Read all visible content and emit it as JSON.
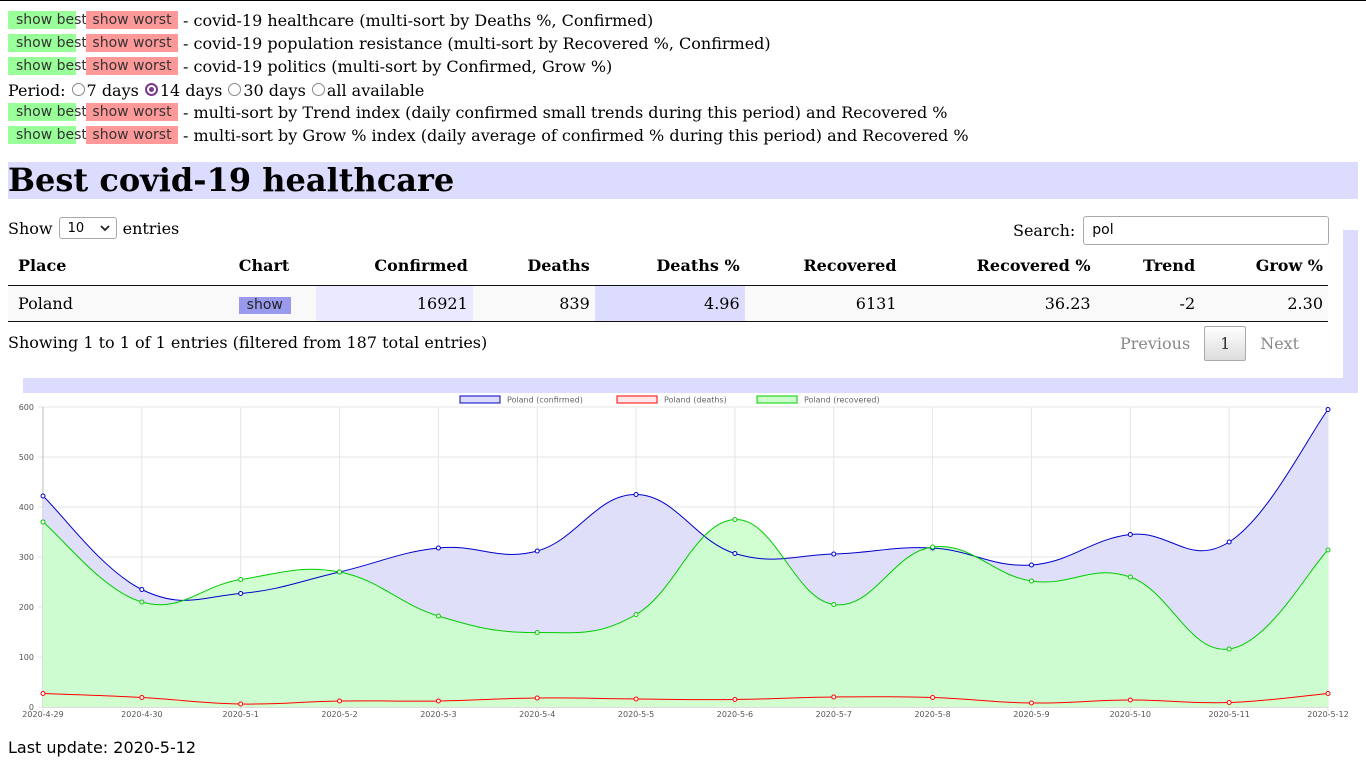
{
  "nav": {
    "best_label": "show best",
    "worst_label": "show worst",
    "rows": [
      {
        "desc": "- covid-19 healthcare (multi-sort by Deaths %, Confirmed)"
      },
      {
        "desc": "- covid-19 population resistance (multi-sort by Recovered %, Confirmed)"
      },
      {
        "desc": "- covid-19 politics (multi-sort by Confirmed, Grow %)"
      }
    ],
    "period_label": "Period:",
    "period_options": [
      "7 days",
      "14 days",
      "30 days",
      "all available"
    ],
    "period_selected": "14 days",
    "period_rows": [
      {
        "desc": "- multi-sort by Trend index (daily confirmed small trends during this period) and Recovered %"
      },
      {
        "desc": "- multi-sort by Grow % index (daily average of confirmed % during this period) and Recovered %"
      }
    ]
  },
  "page_title": "Best covid-19 healthcare",
  "table_controls": {
    "show_label": "Show",
    "entries_value": "10",
    "entries_label": "entries",
    "search_label": "Search:",
    "search_value": "pol"
  },
  "table": {
    "headers": [
      "Place",
      "Chart",
      "Confirmed",
      "Deaths",
      "Deaths %",
      "Recovered",
      "Recovered %",
      "Trend",
      "Grow %"
    ],
    "rows": [
      {
        "place": "Poland",
        "chart_button": "show",
        "confirmed": "16921",
        "deaths": "839",
        "deaths_pct": "4.96",
        "recovered": "6131",
        "recovered_pct": "36.23",
        "trend": "-2",
        "grow_pct": "2.30"
      }
    ],
    "info": "Showing 1 to 1 of 1 entries (filtered from 187 total entries)",
    "pager": {
      "previous": "Previous",
      "current": "1",
      "next": "Next"
    }
  },
  "chart_data": {
    "type": "line",
    "x": [
      "2020-4-29",
      "2020-4-30",
      "2020-5-1",
      "2020-5-2",
      "2020-5-3",
      "2020-5-4",
      "2020-5-5",
      "2020-5-6",
      "2020-5-7",
      "2020-5-8",
      "2020-5-9",
      "2020-5-10",
      "2020-5-11",
      "2020-5-12"
    ],
    "ylim": [
      0,
      600
    ],
    "yticks": [
      0,
      100,
      200,
      300,
      400,
      500,
      600
    ],
    "grid": true,
    "legend_position": "top",
    "series": [
      {
        "name": "Poland (confirmed)",
        "color": "#0000cc",
        "fill": "#dcdcfa",
        "values": [
          422,
          235,
          227,
          270,
          318,
          312,
          425,
          307,
          306,
          318,
          284,
          345,
          330,
          595
        ]
      },
      {
        "name": "Poland (deaths)",
        "color": "#ff0000",
        "fill": "#ffe8e8",
        "values": [
          27,
          19,
          6,
          12,
          12,
          18,
          16,
          15,
          20,
          19,
          8,
          14,
          9,
          27
        ]
      },
      {
        "name": "Poland (recovered)",
        "color": "#00cc00",
        "fill": "#ccffcc",
        "values": [
          370,
          210,
          255,
          270,
          182,
          149,
          185,
          375,
          205,
          320,
          252,
          260,
          116,
          314
        ]
      }
    ]
  },
  "footer": "Last update: 2020-5-12"
}
